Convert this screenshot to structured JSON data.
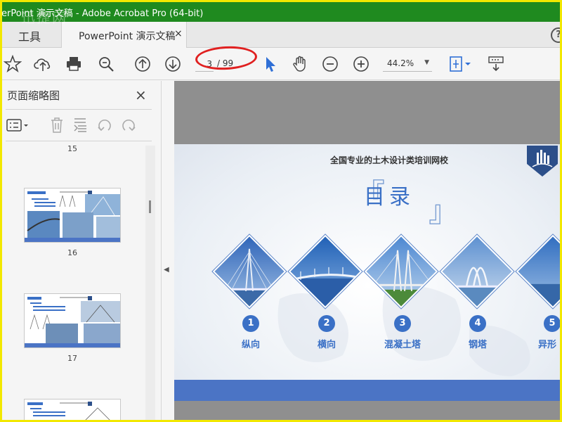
{
  "window": {
    "title": "erPoint 演示文稿 - Adobe Acrobat Pro (64-bit)"
  },
  "watermark": "迅捷网",
  "tabs": {
    "tools_label": "工具",
    "document_label": "PowerPoint 演示文稿",
    "close_glyph": "×",
    "help_glyph": "?"
  },
  "toolbar": {
    "current_page": "3",
    "total_pages": "/ 99",
    "zoom_value": "44.2%",
    "icons": [
      "star-icon",
      "cloud-upload-icon",
      "print-icon",
      "zoom-search-icon",
      "page-up-icon",
      "page-down-icon",
      "select-arrow-icon",
      "hand-icon",
      "zoom-out-icon",
      "zoom-in-icon",
      "fit-page-icon",
      "scroll-mode-icon"
    ]
  },
  "sidebar": {
    "title": "页面缩略图",
    "close_glyph": "×",
    "thumbnails": [
      {
        "label": "15"
      },
      {
        "label": "16"
      },
      {
        "label": "17"
      }
    ]
  },
  "slide": {
    "subtitle": "全国专业的土木设计类培训网校",
    "title": "目录",
    "bracket_left": "『",
    "bracket_right": "』",
    "items": [
      {
        "num": "1",
        "label": "纵向"
      },
      {
        "num": "2",
        "label": "横向"
      },
      {
        "num": "3",
        "label": "混凝土塔"
      },
      {
        "num": "4",
        "label": "钢塔"
      },
      {
        "num": "5",
        "label": "异形"
      }
    ],
    "colors": {
      "accent": "#3a70c6",
      "footer": "#4b74c5"
    }
  },
  "colors": {
    "titlebar": "#1f8a1f",
    "frame": "#f2e800",
    "annotation": "#e02020"
  }
}
